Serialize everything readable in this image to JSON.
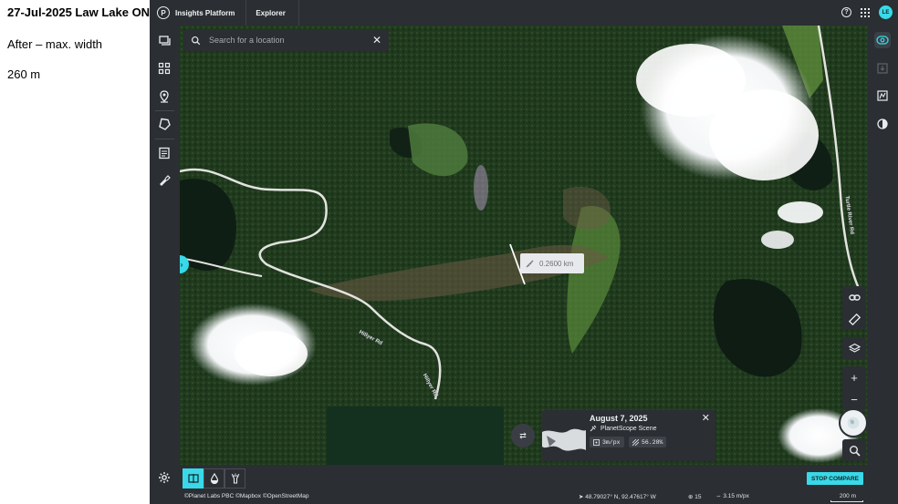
{
  "slide": {
    "title": "27-Jul-2025 Law Lake ON",
    "line1": "After – max. width",
    "line2": "260 m"
  },
  "app": {
    "logo_letter": "P",
    "brand": "Insights Platform",
    "tab": "Explorer",
    "help_symbol": "?",
    "avatar_initials": "LE"
  },
  "search": {
    "placeholder": "Search for a location",
    "value": "",
    "clear_symbol": "✕"
  },
  "map": {
    "expand_symbol": "›",
    "measurement": "0.2600 km",
    "road_labels": [
      "Hillyer Rd",
      "Hillyer Rd",
      "Turtle River Rd"
    ],
    "zoom_in": "+",
    "zoom_out": "−",
    "swap_symbol": "⇄"
  },
  "scene": {
    "date": "August 7, 2025",
    "type": "PlanetScope Scene",
    "resolution": "3m/px",
    "coverage": "56.28%",
    "close_symbol": "✕"
  },
  "bottom": {
    "stop_compare": "STOP COMPARE"
  },
  "status": {
    "attribution": "©Planet Labs PBC ©Mapbox ©OpenStreetMap",
    "coordinates": "48.79027° N, 92.47617° W",
    "zoom": "15",
    "resolution": "3.15 m/px",
    "scale": "200 m"
  },
  "icons": {
    "leftbar": [
      "layers-stack-icon",
      "grid-qr-icon",
      "location-pin-icon",
      "polygon-icon",
      "report-icon",
      "paint-icon"
    ],
    "rightbar": [
      "compare-icon",
      "download-icon",
      "chart-icon",
      "contrast-icon"
    ],
    "tools": [
      "link-icon",
      "ruler-icon",
      "layers-icon"
    ],
    "bottom": [
      "split-view-icon",
      "drop-icon",
      "flashlight-icon",
      "gear-icon"
    ]
  },
  "colors": {
    "accent": "#38d9e8",
    "panel": "#2b2e33",
    "forest": "#1d3219"
  }
}
